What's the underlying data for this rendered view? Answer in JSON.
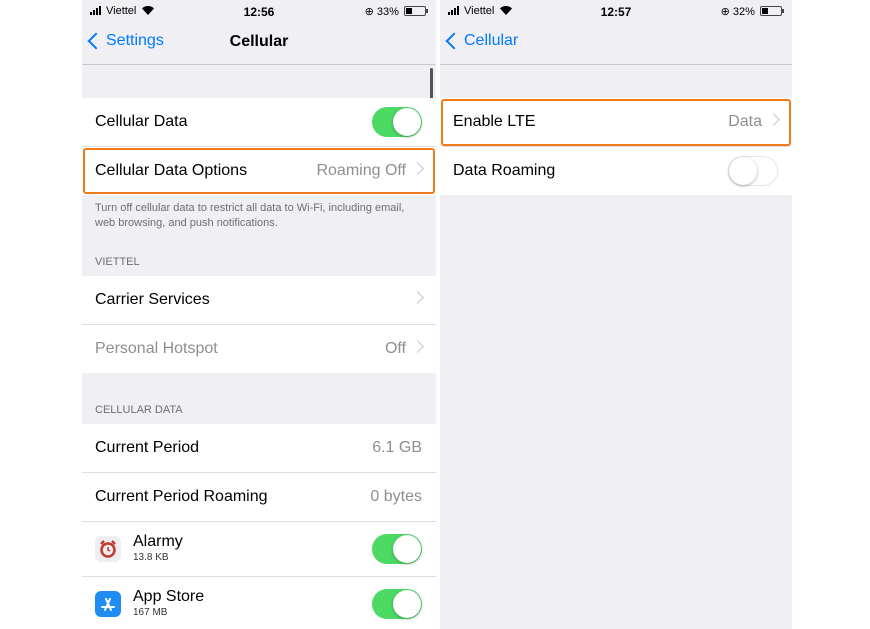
{
  "left": {
    "status": {
      "carrier": "Viettel",
      "time": "12:56",
      "battery": "33%"
    },
    "nav": {
      "back_label": "Settings",
      "title": "Cellular"
    },
    "cellular_data_label": "Cellular Data",
    "cellular_data_options": {
      "label": "Cellular Data Options",
      "value": "Roaming Off"
    },
    "footer_text": "Turn off cellular data to restrict all data to Wi-Fi, including email, web browsing, and push notifications.",
    "carrier_header": "VIETTEL",
    "carrier_services_label": "Carrier Services",
    "personal_hotspot": {
      "label": "Personal Hotspot",
      "value": "Off"
    },
    "cellular_data_header": "CELLULAR DATA",
    "current_period": {
      "label": "Current Period",
      "value": "6.1 GB"
    },
    "current_period_roaming": {
      "label": "Current Period Roaming",
      "value": "0 bytes"
    },
    "apps": [
      {
        "name": "Alarmy",
        "size": "13.8 KB",
        "icon": "alarm-clock-icon",
        "color": "#e8e8ee"
      },
      {
        "name": "App Store",
        "size": "167 MB",
        "icon": "app-store-icon",
        "color": "#1e8cf0"
      }
    ]
  },
  "right": {
    "status": {
      "carrier": "Viettel",
      "time": "12:57",
      "battery": "32%"
    },
    "nav": {
      "back_label": "Cellular"
    },
    "enable_lte": {
      "label": "Enable LTE",
      "value": "Data"
    },
    "data_roaming_label": "Data Roaming"
  },
  "colors": {
    "accent": "#007aff",
    "toggle_on": "#4cd964",
    "highlight": "#f07a1a"
  }
}
